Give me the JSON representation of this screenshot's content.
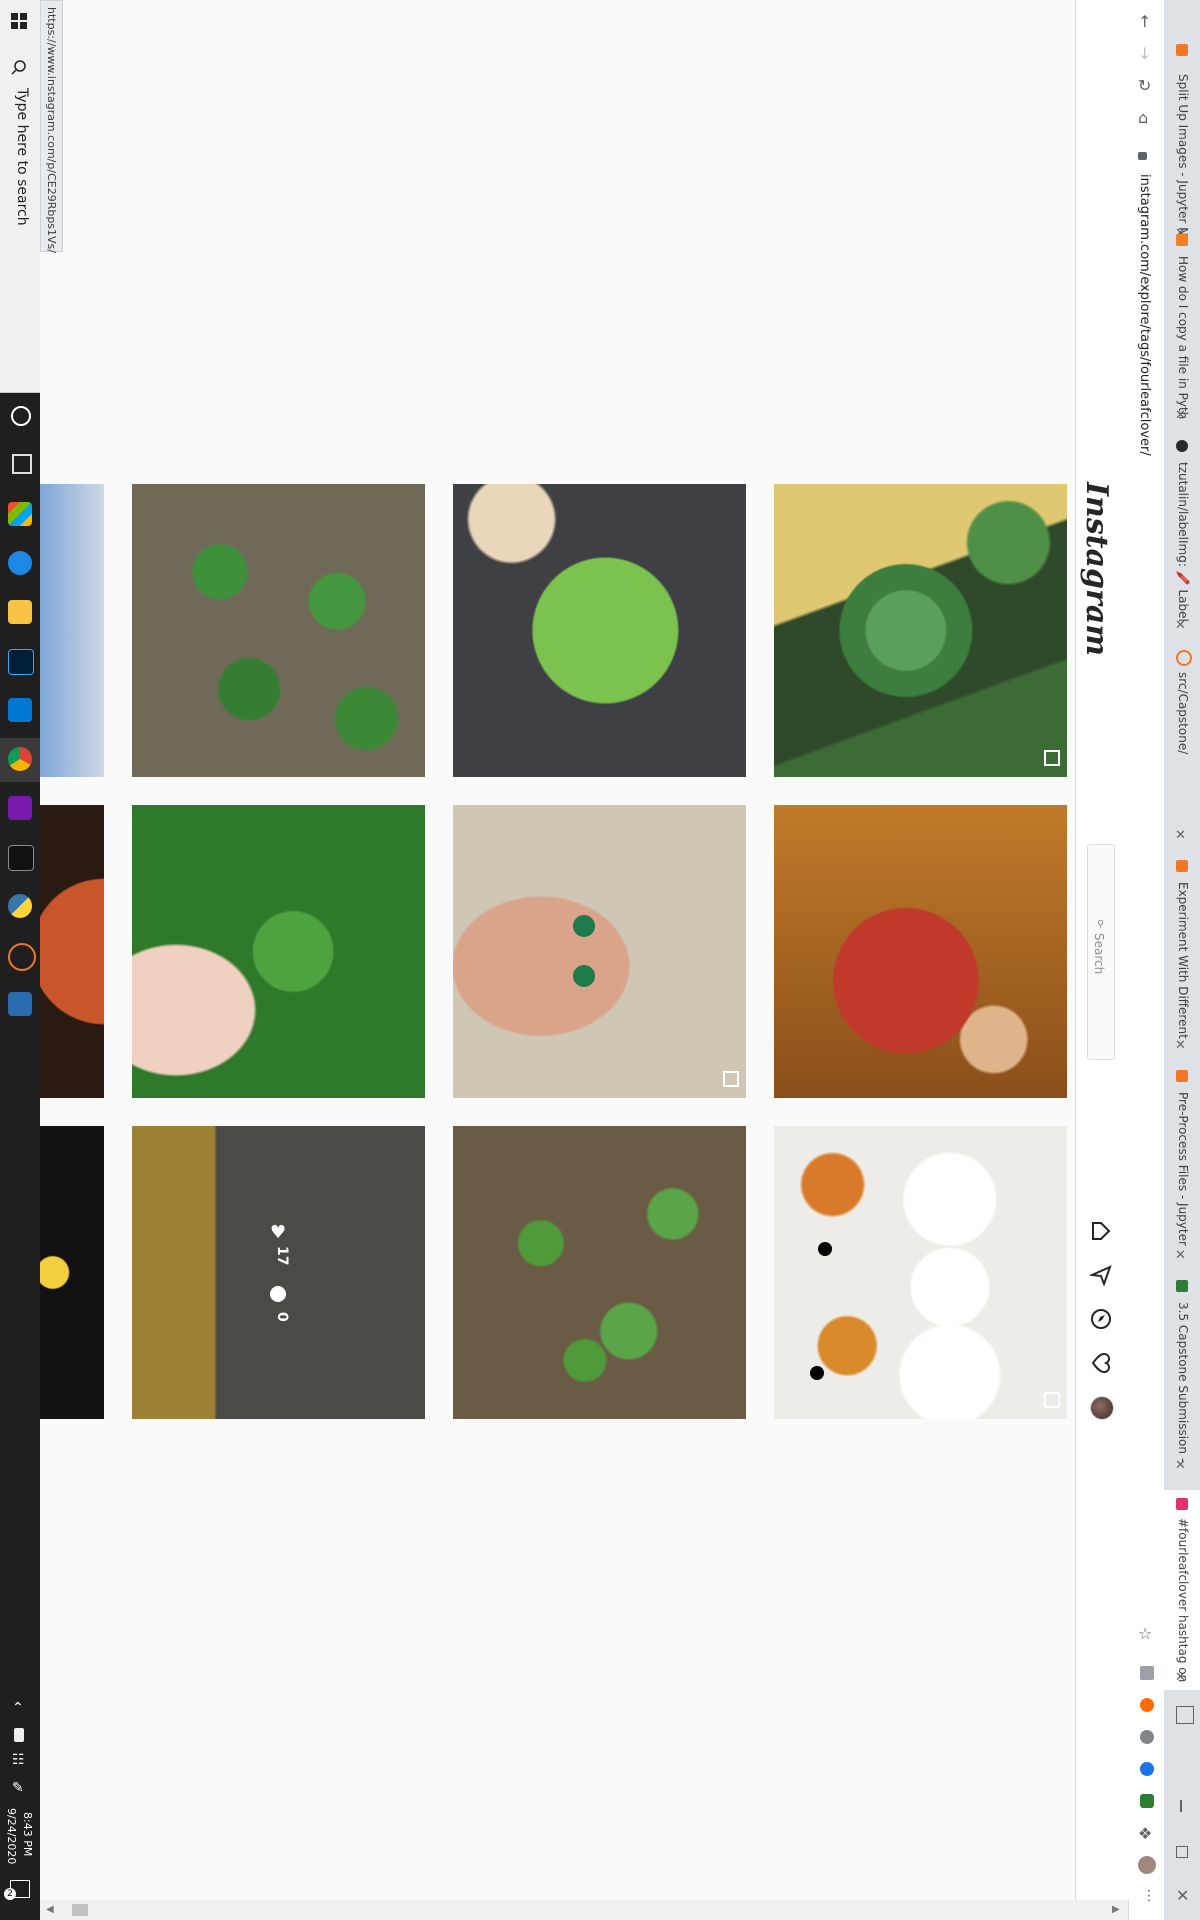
{
  "status_link": "https://www.instagram.com/p/CE29Rbps1Vs/",
  "taskbar": {
    "search_placeholder": "Type here to search",
    "time": "8:43 PM",
    "date": "9/24/2020",
    "notification_count": "2"
  },
  "browser": {
    "tabs": [
      {
        "label": "Split Up Images - Jupyter N",
        "favicon_color": "#f37626"
      },
      {
        "label": "How do I copy a file in Pyth",
        "favicon_color": "#f48024"
      },
      {
        "label": "tzutalin/labelImg: 🖍️ Label",
        "favicon_color": "#24292e"
      },
      {
        "label": "src/Capstone/",
        "favicon_color": "#f37626"
      },
      {
        "label": "Experiment With Different",
        "favicon_color": "#f37626"
      },
      {
        "label": "Pre-Process Files - Jupyter",
        "favicon_color": "#f37626"
      },
      {
        "label": "3.5 Capstone Submission -",
        "favicon_color": "#2e7d32"
      },
      {
        "label": "#fourleafclover hashtag on",
        "favicon_color": "#e1306c"
      }
    ],
    "address": "instagram.com/explore/tags/fourleafclover/",
    "nav": [
      "back-icon",
      "forward-icon",
      "reload-icon",
      "home-icon"
    ]
  },
  "instagram": {
    "logo": "Instagram",
    "search_placeholder": "Search",
    "nav_icons": [
      "home-icon",
      "direct-icon",
      "explore-icon",
      "activity-icon",
      "profile-avatar"
    ],
    "hover_likes": "17",
    "hover_comments": "0"
  },
  "colors": {
    "taskbar": "#1f1f1f",
    "accent": "#0095f6"
  }
}
